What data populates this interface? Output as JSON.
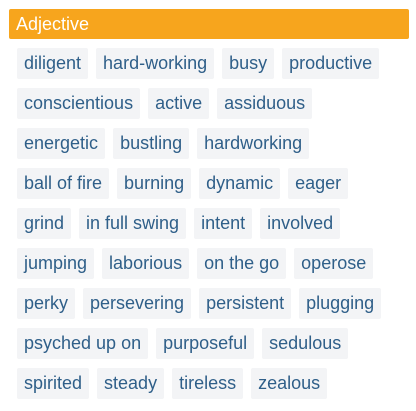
{
  "header": {
    "title": "Adjective"
  },
  "synonyms": [
    "diligent",
    "hard-working",
    "busy",
    "productive",
    "conscientious",
    "active",
    "assiduous",
    "energetic",
    "bustling",
    "hardworking",
    "ball of fire",
    "burning",
    "dynamic",
    "eager",
    "grind",
    "in full swing",
    "intent",
    "involved",
    "jumping",
    "laborious",
    "on the go",
    "operose",
    "perky",
    "persevering",
    "persistent",
    "plugging",
    "psyched up on",
    "purposeful",
    "sedulous",
    "spirited",
    "steady",
    "tireless",
    "zealous"
  ],
  "colors": {
    "header_bg": "#f7a51d",
    "chip_bg": "#f3f4f6",
    "chip_text": "#2f5f89"
  }
}
